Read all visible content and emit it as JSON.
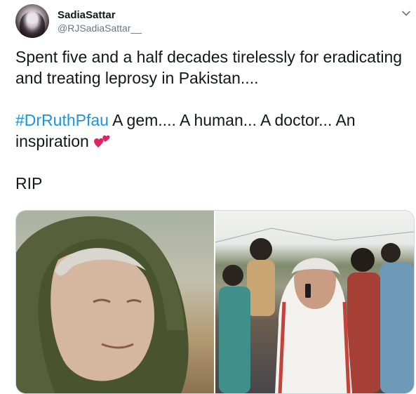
{
  "tweet": {
    "author": {
      "display_name": "SadiaSattar",
      "handle": "@RJSadiaSattar__"
    },
    "text": {
      "line1": "Spent five and a half decades tirelessly for eradicating and treating leprosy in Pakistan....",
      "hashtag": "#DrRuthPfau",
      "line2_after_hashtag": " A gem.... A human... A doctor... An inspiration ",
      "line3": "RIP"
    },
    "media": {
      "photo_count": 2
    }
  },
  "icons": {
    "menu": "chevron-down-icon",
    "emoji": "two-hearts-emoji"
  },
  "colors": {
    "link": "#1b95e0",
    "text": "#14171a",
    "secondary": "#657786",
    "border": "#ccd6dd"
  }
}
